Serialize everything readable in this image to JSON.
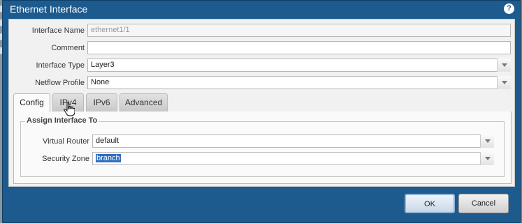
{
  "dialog": {
    "title": "Ethernet Interface",
    "help_icon": "question-circle-icon",
    "help_glyph": "?"
  },
  "form": {
    "interface_name": {
      "label": "Interface Name",
      "value": "ethernet1/1"
    },
    "comment": {
      "label": "Comment",
      "value": ""
    },
    "interface_type": {
      "label": "Interface Type",
      "value": "Layer3"
    },
    "netflow_profile": {
      "label": "Netflow Profile",
      "value": "None"
    }
  },
  "tabs": [
    {
      "label": "Config",
      "active": true
    },
    {
      "label": "IPv4",
      "active": false
    },
    {
      "label": "IPv6",
      "active": false
    },
    {
      "label": "Advanced",
      "active": false
    }
  ],
  "assign": {
    "legend": "Assign Interface To",
    "virtual_router": {
      "label": "Virtual Router",
      "value": "default"
    },
    "security_zone": {
      "label": "Security Zone",
      "value": "branch"
    }
  },
  "buttons": {
    "ok": "OK",
    "cancel": "Cancel"
  },
  "colors": {
    "titlebar": "#1d5a8e",
    "selection": "#2f6fc4"
  }
}
